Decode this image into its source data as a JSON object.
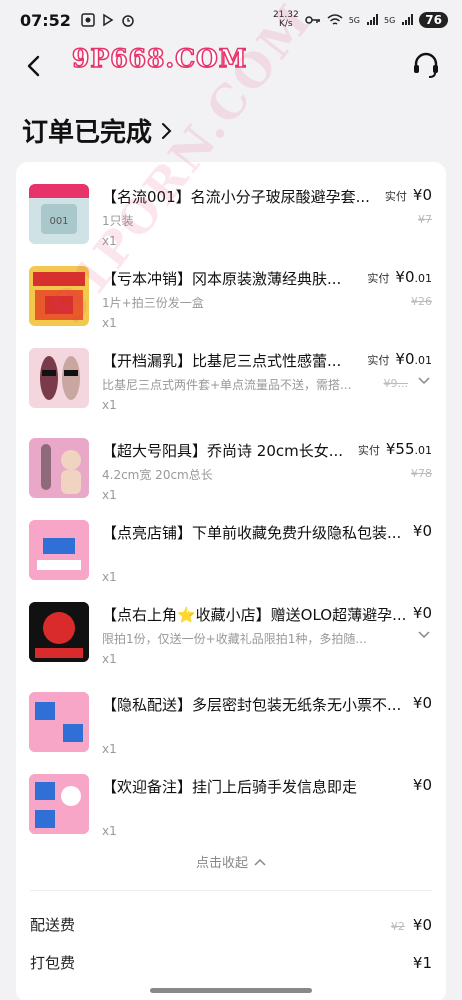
{
  "status_bar": {
    "time": "07:52",
    "net_speed_value": "21.32",
    "net_speed_unit": "K/s",
    "signal_1": "5G",
    "signal_2": "5G",
    "battery": "76"
  },
  "watermark": {
    "logo": "9P668.COM",
    "diagonal": "91PORN.COM"
  },
  "page": {
    "title": "订单已完成"
  },
  "items": [
    {
      "title": "【名流001】名流小分子玻尿酸避孕套...",
      "spec": "1只装",
      "qty": "x1",
      "price_label": "实付",
      "price_yen": "¥0",
      "price_cents": "",
      "orig_price": "¥7",
      "thumb_color": "#cfe3e6",
      "thumb_accent": "#8aa"
    },
    {
      "title": "【亏本冲销】冈本原装激薄经典肤...",
      "spec": "1片+拍三份发一盒",
      "qty": "x1",
      "price_label": "实付",
      "price_yen": "¥0",
      "price_cents": ".01",
      "orig_price": "¥26",
      "thumb_color": "#f2c94c",
      "thumb_accent": "#d6302f"
    },
    {
      "title": "【开档漏乳】比基尼三点式性感蕾...",
      "spec": "比基尼三点式两件套+单点流量品不送，需搭...",
      "qty": "x1",
      "price_label": "实付",
      "price_yen": "¥0",
      "price_cents": ".01",
      "orig_price": "¥9...",
      "thumb_color": "#f4d6df",
      "thumb_accent": "#7a3a4a"
    },
    {
      "title": "【超大号阳具】乔尚诗 20cm长女...",
      "spec": "4.2cm宽 20cm总长",
      "qty": "x1",
      "price_label": "实付",
      "price_yen": "¥55",
      "price_cents": ".01",
      "orig_price": "¥78",
      "thumb_color": "#e9a8c8",
      "thumb_accent": "#8f6a7a"
    },
    {
      "title": "【点亮店铺】下单前收藏免费升级隐私包装...",
      "spec": "",
      "qty": "x1",
      "price_label": "",
      "price_yen": "¥0",
      "price_cents": "",
      "orig_price": "",
      "thumb_color": "#f7a6c8",
      "thumb_accent": "#2f6fd6"
    },
    {
      "title": "【点右上角⭐收藏小店】赠送OLO超薄避孕...",
      "spec": "限拍1份，仅送一份+收藏礼品限拍1种，多拍随...",
      "qty": "x1",
      "price_label": "",
      "price_yen": "¥0",
      "price_cents": "",
      "orig_price": "",
      "thumb_color": "#d92b2b",
      "thumb_accent": "#111111"
    },
    {
      "title": "【隐私配送】多层密封包装无纸条无小票不...",
      "spec": "",
      "qty": "x1",
      "price_label": "",
      "price_yen": "¥0",
      "price_cents": "",
      "orig_price": "",
      "thumb_color": "#f7a6c8",
      "thumb_accent": "#2f6fd6"
    },
    {
      "title": "【欢迎备注】挂门上后骑手发信息即走",
      "spec": "",
      "qty": "x1",
      "price_label": "",
      "price_yen": "¥0",
      "price_cents": "",
      "orig_price": "",
      "thumb_color": "#f7a6c8",
      "thumb_accent": "#2f6fd6"
    }
  ],
  "collapse": {
    "label": "点击收起"
  },
  "fees": [
    {
      "label": "配送费",
      "orig": "¥2",
      "value": "¥0"
    },
    {
      "label": "打包费",
      "orig": "",
      "value": "¥1"
    }
  ],
  "colors": {
    "brand": "#e8326a",
    "card": "#ffffff",
    "page_bg": "#f2f2f4"
  }
}
